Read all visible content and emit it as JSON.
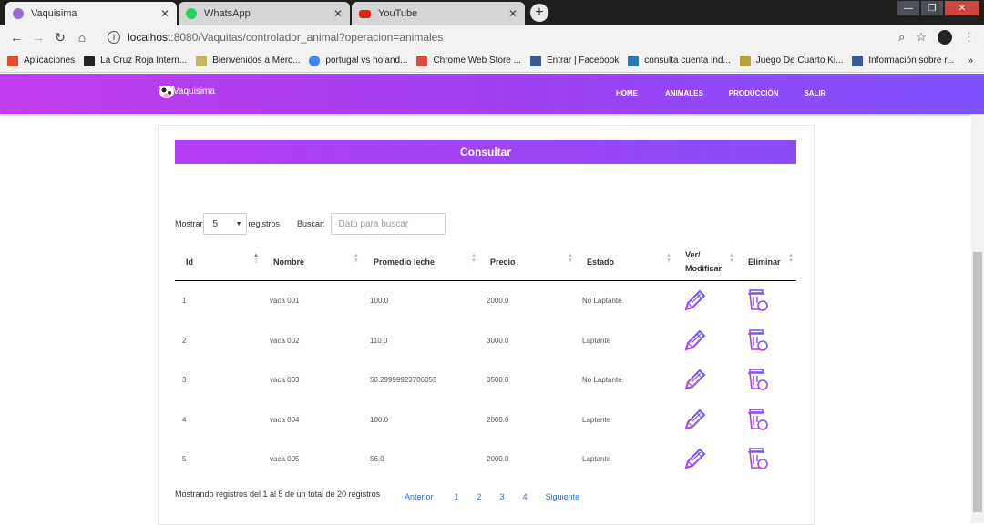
{
  "browser": {
    "tabs": [
      {
        "title": "Vaquisima",
        "active": true,
        "favicon_color": "#9a6cd9"
      },
      {
        "title": "WhatsApp",
        "active": false,
        "favicon_color": "#25d366"
      },
      {
        "title": "YouTube",
        "active": false,
        "favicon_color": "#e62117"
      }
    ],
    "tab_close": "✕",
    "new_tab": "+",
    "url_host": "localhost",
    "url_path": ":8080/Vaquitas/controlador_animal?operacion=animales",
    "bookmarks": [
      {
        "label": "Aplicaciones",
        "icon": "apps-grid-icon",
        "color": "#e34c26"
      },
      {
        "label": "La Cruz Roja Intern...",
        "icon": "bookmark-site-icon",
        "color": "#222222"
      },
      {
        "label": "Bienvenidos a Merc...",
        "icon": "bookmark-site-icon",
        "color": "#c7b35a"
      },
      {
        "label": "portugal vs holand...",
        "icon": "google-icon",
        "color": "#4285f4"
      },
      {
        "label": "Chrome Web Store ...",
        "icon": "bookmark-site-icon",
        "color": "#d64a3f"
      },
      {
        "label": "Entrar | Facebook",
        "icon": "facebook-icon",
        "color": "#3b5998"
      },
      {
        "label": "consulta cuenta ind...",
        "icon": "bookmark-site-icon",
        "color": "#2a7ab0"
      },
      {
        "label": "Juego De Cuarto Ki...",
        "icon": "bookmark-site-icon",
        "color": "#b5a03a"
      },
      {
        "label": "Información sobre r...",
        "icon": "facebook-icon",
        "color": "#3b5998"
      }
    ],
    "bookmarks_more": "»"
  },
  "navbar": {
    "brand": "Vaquisima",
    "menu": [
      "HOME",
      "ANIMALES",
      "PRODUCCIÓN",
      "SALIR"
    ],
    "gradient": [
      "#c13df0",
      "#7d52ff"
    ]
  },
  "page": {
    "header": "Consultar",
    "show_label": "Mostrar",
    "page_size": "5",
    "records_label": "registros",
    "search_label": "Buscar:",
    "search_placeholder": "Dato para buscar",
    "columns": [
      "Id",
      "Nombre",
      "Promedio leche",
      "Precio",
      "Estado",
      "Ver/ Modificar",
      "Eliminar"
    ],
    "rows": [
      {
        "id": "1",
        "nombre": "vaca 001",
        "leche": "100.0",
        "precio": "2000.0",
        "estado": "No Laptante"
      },
      {
        "id": "2",
        "nombre": "vaca 002",
        "leche": "110.0",
        "precio": "3000.0",
        "estado": "Laptante"
      },
      {
        "id": "3",
        "nombre": "vaca 003",
        "leche": "50.29999923706055",
        "precio": "3500.0",
        "estado": "No Laptante"
      },
      {
        "id": "4",
        "nombre": "vaca 004",
        "leche": "100.0",
        "precio": "2000.0",
        "estado": "Laptante"
      },
      {
        "id": "5",
        "nombre": "vaca 005",
        "leche": "56.0",
        "precio": "2000.0",
        "estado": "Laptante"
      }
    ],
    "info": "Mostrando registros del 1 al 5 de un total de 20 registros",
    "pager": [
      "Anterior",
      "1",
      "2",
      "3",
      "4",
      "Siguiente"
    ],
    "link_color": "#2f6fd0"
  }
}
